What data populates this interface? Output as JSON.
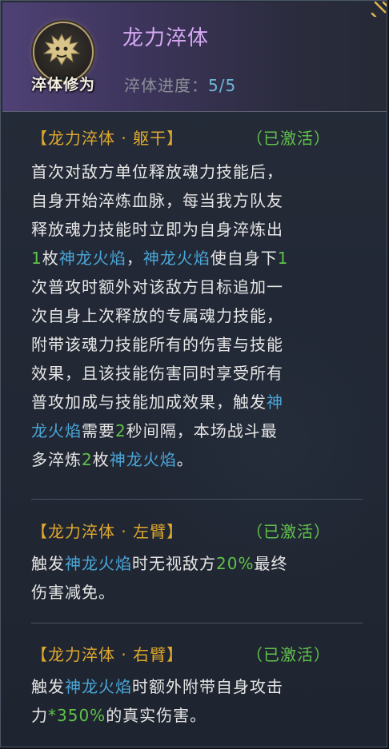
{
  "header": {
    "title": "龙力淬体",
    "emblem_label": "淬体修为",
    "progress_label": "淬体进度：",
    "progress_value": "5/5"
  },
  "sections": [
    {
      "head_open": "【龙力淬体 · ",
      "part": "躯干",
      "head_close": "】",
      "status": "（已激活）",
      "lines": [
        "首次对敌方单位释放魂力技能后，",
        "自身开始淬炼血脉，每当我方队友",
        "释放魂力技能时立即为自身淬炼出"
      ],
      "l4": {
        "num1": "1",
        "t1": "枚",
        "kw1": "神龙火焰",
        "t2": "，",
        "kw2": "神龙火焰",
        "t3": "使自身下",
        "num2": "1"
      },
      "lines2": [
        "次普攻时额外对该敌方目标追加一",
        "次自身上次释放的专属魂力技能，",
        "附带该魂力技能所有的伤害与技能",
        "效果，且该技能伤害同时享受所有"
      ],
      "l9": {
        "t1": "普攻加成与技能加成效果，触发",
        "kw1": "神"
      },
      "l10": {
        "kw1": "龙火焰",
        "t1": "需要",
        "num1": "2",
        "t2": "秒间隔，本场战斗最"
      },
      "l11": {
        "t1": "多淬炼",
        "num1": "2",
        "t2": "枚",
        "kw1": "神龙火焰",
        "t3": "。"
      }
    },
    {
      "head_open": "【龙力淬体 · ",
      "part": "左臂",
      "head_close": "】",
      "status": "（已激活）",
      "l1": {
        "t1": "触发",
        "kw1": "神龙火焰",
        "t2": "时无视敌方",
        "num1": "20%",
        "t3": "最终"
      },
      "l2": "伤害减免。"
    },
    {
      "head_open": "【龙力淬体 · ",
      "part": "右臂",
      "head_close": "】",
      "status": "（已激活）",
      "l1": {
        "t1": "触发",
        "kw1": "神龙火焰",
        "t2": "时额外附带自身攻击"
      },
      "l2": {
        "t1": "力",
        "num1": "*350%",
        "t2": "的真实伤害。"
      }
    }
  ],
  "colors": {
    "title": "#d6a8f2",
    "section_head": "#e0a92d",
    "activated": "#5fc24a",
    "keyword": "#4aa6d8",
    "number": "#5fc24a",
    "body_text": "#e6e6e6"
  }
}
